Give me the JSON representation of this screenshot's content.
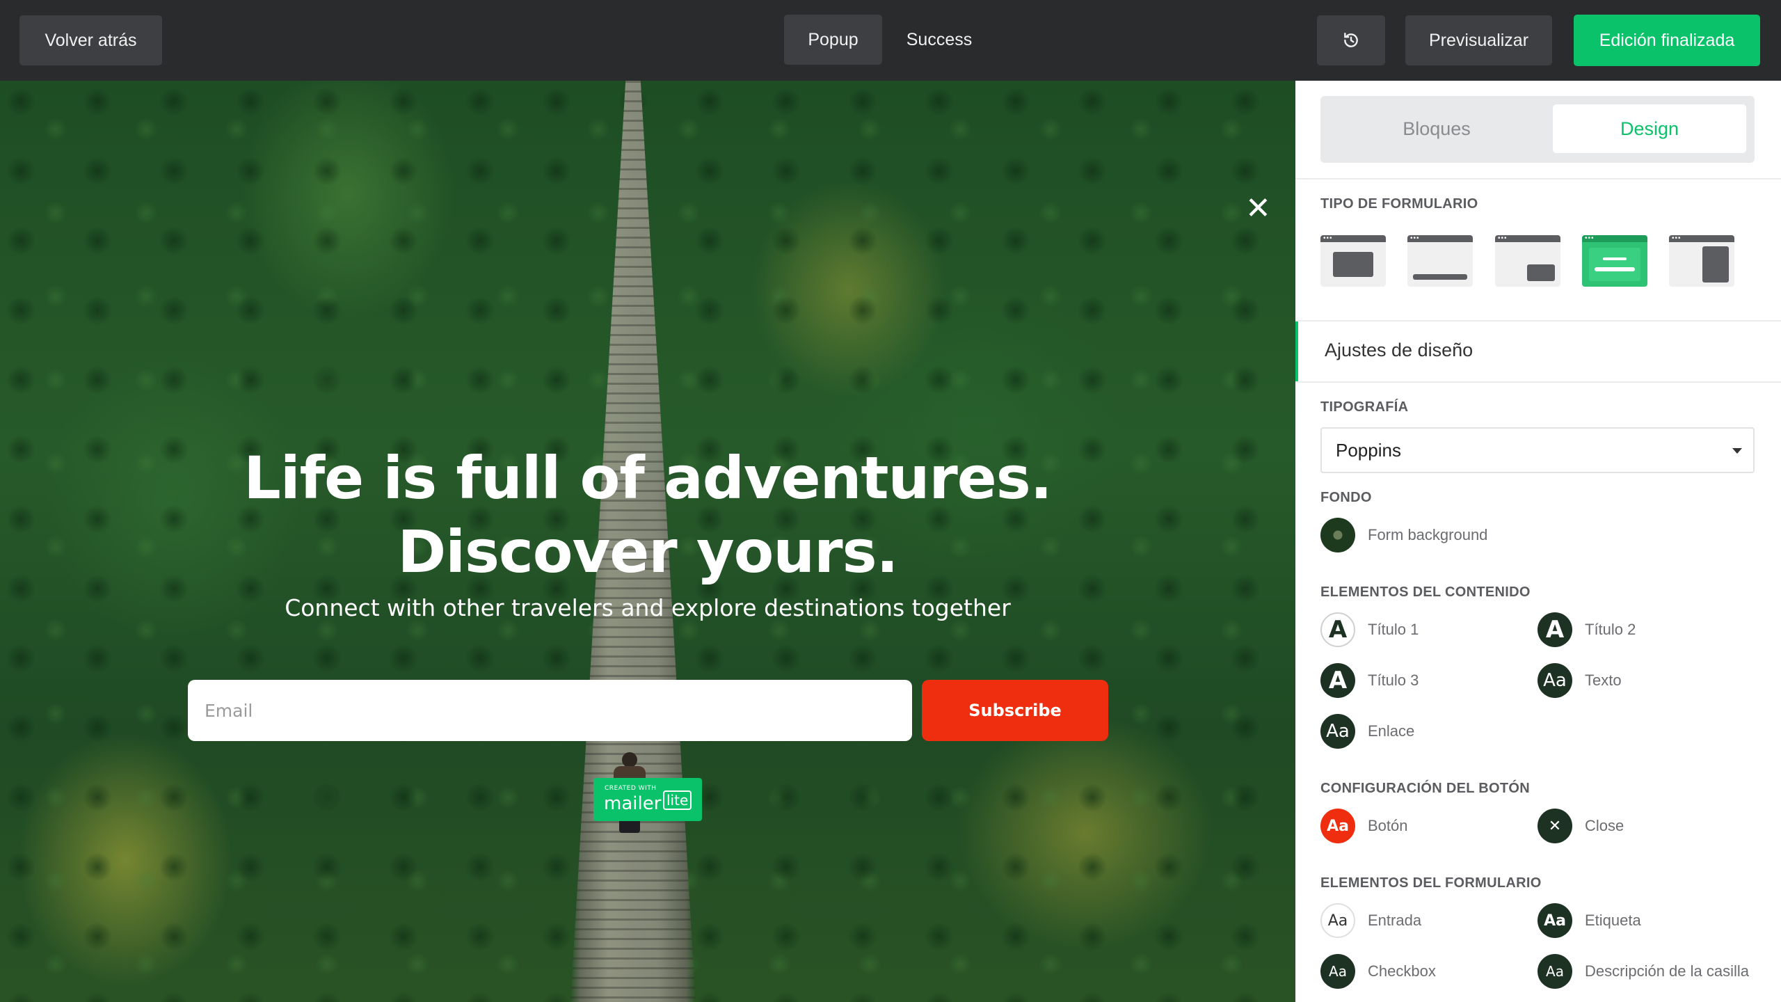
{
  "topbar": {
    "back_label": "Volver atrás",
    "tab_popup": "Popup",
    "tab_success": "Success",
    "history_icon": "history-icon",
    "preview_label": "Previsualizar",
    "done_label": "Edición finalizada"
  },
  "canvas": {
    "close_glyph": "✕",
    "headline_line1": "Life is full of adventures.",
    "headline_line2": "Discover yours.",
    "subheadline": "Connect with other travelers and explore destinations together",
    "email_placeholder": "Email",
    "subscribe_label": "Subscribe",
    "badge_small": "CREATED WITH",
    "badge_brand": "mailer",
    "badge_lite": "lite"
  },
  "panel": {
    "tabs": [
      "Bloques",
      "Design"
    ],
    "form_type_heading": "TIPO DE FORMULARIO",
    "design_settings": "Ajustes de diseño",
    "typography_heading": "TIPOGRAFÍA",
    "font_value": "Poppins",
    "background_heading": "FONDO",
    "background_item": "Form background",
    "content_heading": "ELEMENTOS DEL CONTENIDO",
    "content_items": [
      "Título 1",
      "Título 2",
      "Título 3",
      "Texto",
      "Enlace"
    ],
    "button_heading": "CONFIGURACIÓN DEL BOTÓN",
    "button_items": [
      "Botón",
      "Close"
    ],
    "form_heading": "ELEMENTOS DEL FORMULARIO",
    "form_items": [
      "Entrada",
      "Etiqueta",
      "Checkbox",
      "Descripción de la casilla"
    ],
    "glyph_A": "A",
    "glyph_Aa": "Aa",
    "glyph_x": "✕"
  },
  "colors": {
    "accent": "#09c269",
    "subscribe": "#ef2d0f",
    "topbar": "#2a2b2d"
  }
}
